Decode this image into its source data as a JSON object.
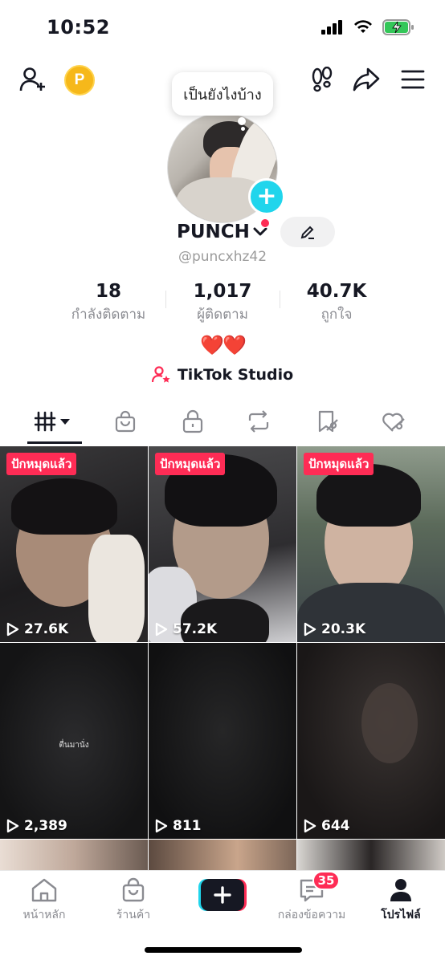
{
  "status_bar": {
    "time": "10:52"
  },
  "profile": {
    "bubble_text": "เป็นยังไงบ้าง",
    "name": "PUNCH",
    "handle": "@puncxhz42",
    "bio_emoji": "❤️❤️",
    "studio_label": "TikTok Studio"
  },
  "stats": [
    {
      "value": "18",
      "label": "กำลังติดตาม"
    },
    {
      "value": "1,017",
      "label": "ผู้ติดตาม"
    },
    {
      "value": "40.7K",
      "label": "ถูกใจ"
    }
  ],
  "tabs": [
    {
      "icon": "videos-grid-icon",
      "active": true
    },
    {
      "icon": "shop-bag-icon"
    },
    {
      "icon": "lock-icon"
    },
    {
      "icon": "repost-icon"
    },
    {
      "icon": "favorites-icon"
    },
    {
      "icon": "liked-icon"
    }
  ],
  "videos": [
    {
      "badge": "ปักหมุดแล้ว",
      "views": "27.6K"
    },
    {
      "badge": "ปักหมุดแล้ว",
      "views": "57.2K"
    },
    {
      "badge": "ปักหมุดแล้ว",
      "views": "20.3K"
    },
    {
      "views": "2,389",
      "caption": "ตื่นมานั่ง"
    },
    {
      "views": "811"
    },
    {
      "views": "644"
    }
  ],
  "bottom_nav": {
    "home": "หน้าหลัก",
    "shop": "ร้านค้า",
    "inbox": "กล่องข้อความ",
    "inbox_badge": "35",
    "profile": "โปรไฟล์"
  },
  "colors": {
    "accent": "#fe2c55",
    "cyan": "#20d5ec"
  }
}
